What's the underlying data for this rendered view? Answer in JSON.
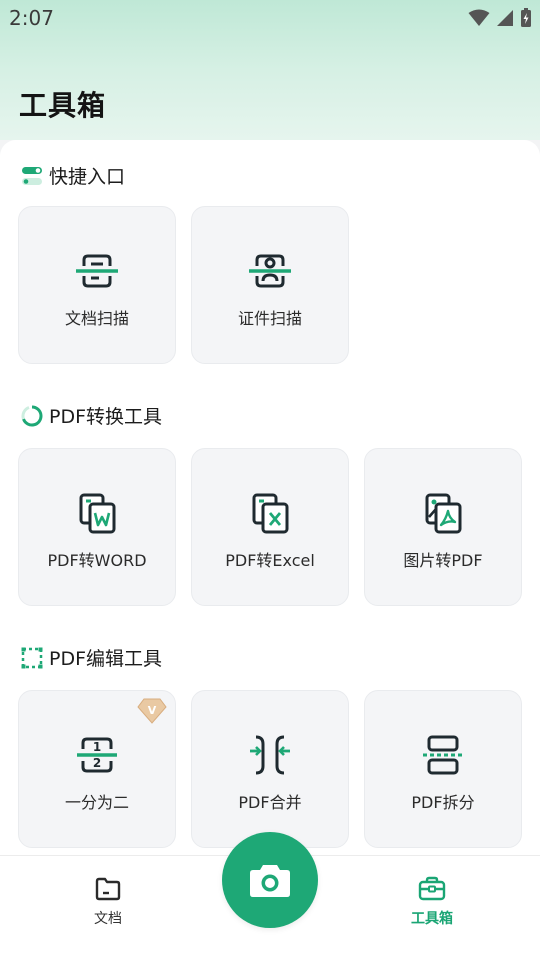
{
  "status_bar": {
    "time": "2:07"
  },
  "page_title": "工具箱",
  "sections": [
    {
      "title": "快捷入口",
      "icon": "toggle-icon",
      "items": [
        {
          "label": "文档扫描",
          "icon": "document-scan-icon"
        },
        {
          "label": "证件扫描",
          "icon": "id-scan-icon"
        }
      ]
    },
    {
      "title": "PDF转换工具",
      "icon": "refresh-ring-icon",
      "items": [
        {
          "label": "PDF转WORD",
          "icon": "pdf-to-word-icon"
        },
        {
          "label": "PDF转Excel",
          "icon": "pdf-to-excel-icon"
        },
        {
          "label": "图片转PDF",
          "icon": "image-to-pdf-icon"
        }
      ]
    },
    {
      "title": "PDF编辑工具",
      "icon": "dashed-frame-icon",
      "items": [
        {
          "label": "一分为二",
          "icon": "split-in-two-icon",
          "vip": true,
          "vip_badge": "V"
        },
        {
          "label": "PDF合并",
          "icon": "merge-icon"
        },
        {
          "label": "PDF拆分",
          "icon": "split-icon"
        }
      ]
    }
  ],
  "split_icon_numbers": [
    "1",
    "2"
  ],
  "bottom_nav": [
    {
      "label": "文档",
      "icon": "folder-icon",
      "active": false
    },
    {
      "label": "工具箱",
      "icon": "toolbox-icon",
      "active": true
    }
  ],
  "camera_button": {
    "icon": "camera-icon"
  },
  "colors": {
    "accent": "#1ea876",
    "active_nav": "#1aa574",
    "card_bg": "#f4f5f7",
    "header_gradient_top": "#bfe8d6"
  }
}
